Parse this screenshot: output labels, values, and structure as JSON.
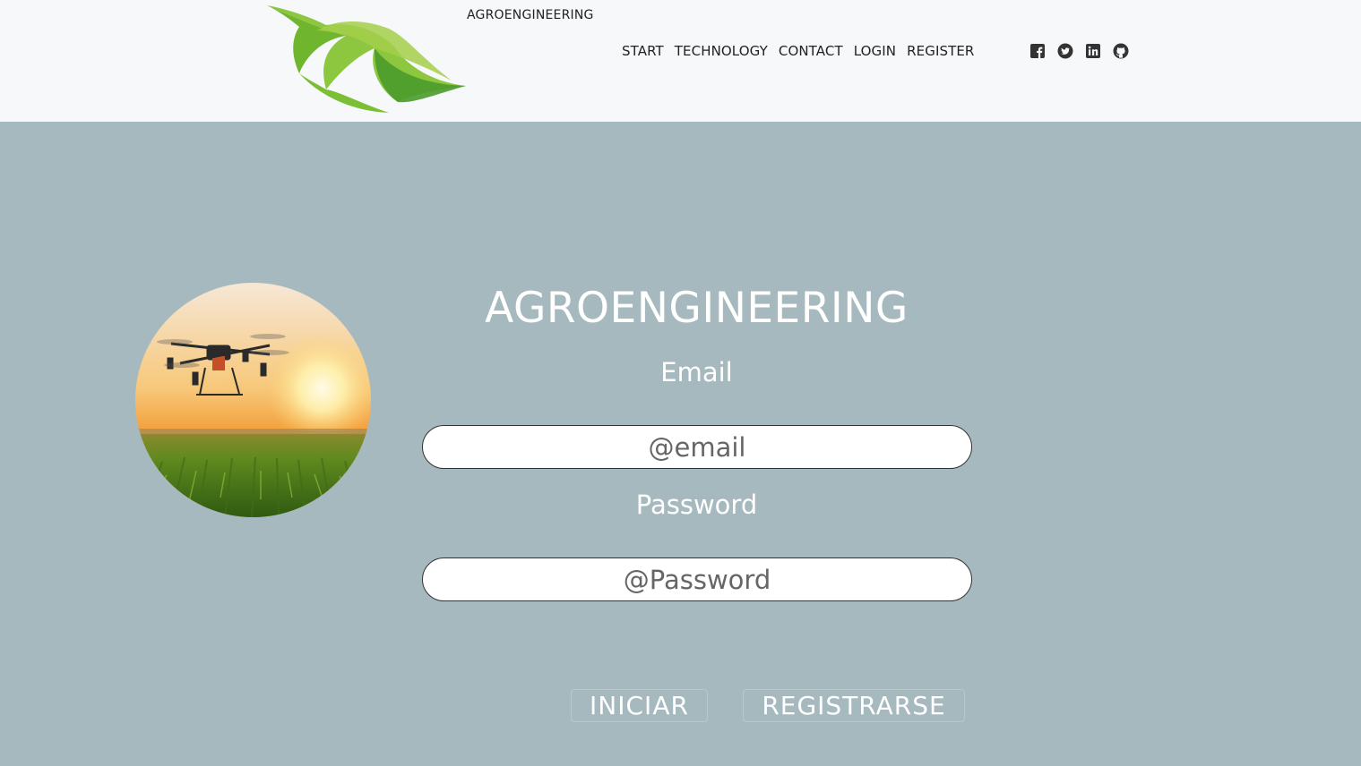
{
  "header": {
    "brand": "AGROENGINEERING",
    "nav": [
      "START",
      "TECHNOLOGY",
      "CONTACT",
      "LOGIN",
      "REGISTER"
    ],
    "social_icons": [
      "facebook-icon",
      "twitter-icon",
      "linkedin-icon",
      "github-icon"
    ]
  },
  "login": {
    "title": "AGROENGINEERING",
    "email_label": "Email",
    "email_placeholder": "@email",
    "password_label": "Password",
    "password_placeholder": "@Password",
    "login_button": "INICIAR",
    "register_button": "REGISTRARSE"
  },
  "colors": {
    "background": "#a6b9bf",
    "header": "#f7f8fa",
    "leaf_light": "#8dc63f",
    "leaf_dark": "#4a9a2a"
  }
}
